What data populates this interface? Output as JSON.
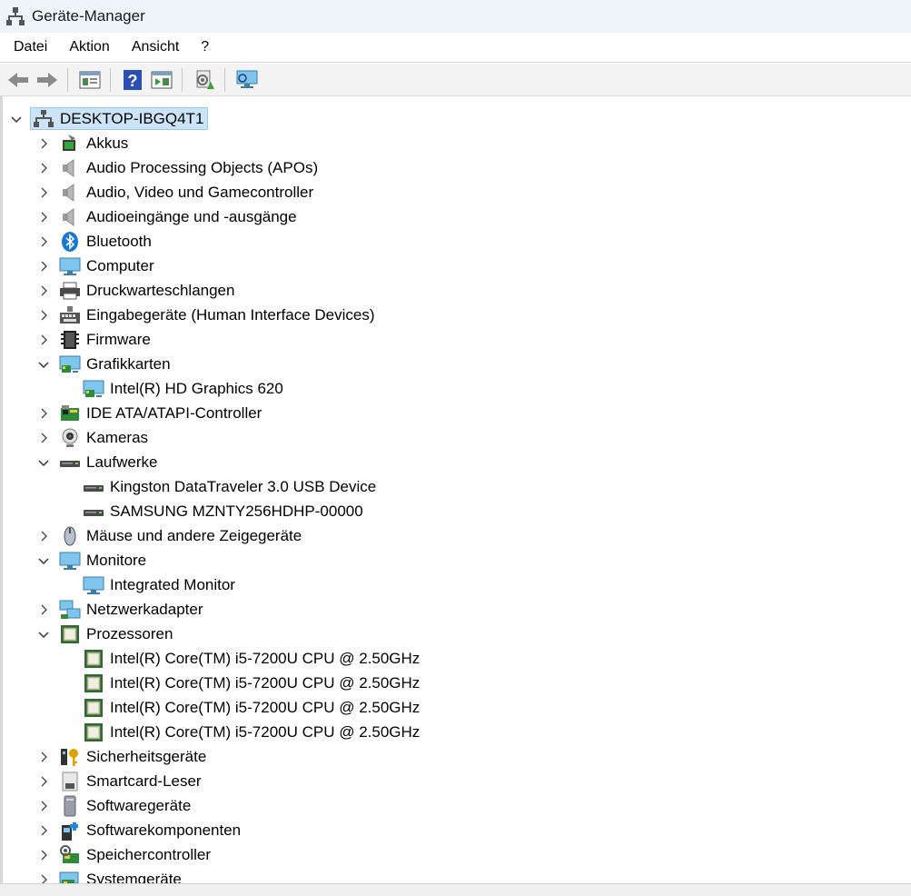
{
  "window": {
    "title": "Geräte-Manager"
  },
  "menu": [
    "Datei",
    "Aktion",
    "Ansicht",
    "?"
  ],
  "toolbar": {
    "buttons": [
      "back-arrow-icon",
      "forward-arrow-icon",
      "show-hide-console-tree-icon",
      "help-icon",
      "action-pane-icon",
      "update-driver-icon",
      "scan-hardware-changes-icon"
    ]
  },
  "tree": {
    "root": "DESKTOP-IBGQ4T1",
    "items": [
      {
        "label": "Akkus",
        "icon": "battery-icon",
        "level": 1,
        "state": "collapsed"
      },
      {
        "label": "Audio Processing Objects (APOs)",
        "icon": "speaker-icon",
        "level": 1,
        "state": "collapsed"
      },
      {
        "label": "Audio, Video und Gamecontroller",
        "icon": "speaker-icon",
        "level": 1,
        "state": "collapsed"
      },
      {
        "label": "Audioeingänge und -ausgänge",
        "icon": "speaker-icon",
        "level": 1,
        "state": "collapsed"
      },
      {
        "label": "Bluetooth",
        "icon": "bluetooth-icon",
        "level": 1,
        "state": "collapsed"
      },
      {
        "label": "Computer",
        "icon": "monitor-icon",
        "level": 1,
        "state": "collapsed"
      },
      {
        "label": "Druckwarteschlangen",
        "icon": "printer-icon",
        "level": 1,
        "state": "collapsed"
      },
      {
        "label": "Eingabegeräte (Human Interface Devices)",
        "icon": "keyboard-icon",
        "level": 1,
        "state": "collapsed"
      },
      {
        "label": "Firmware",
        "icon": "firmware-chip-icon",
        "level": 1,
        "state": "collapsed"
      },
      {
        "label": "Grafikkarten",
        "icon": "display-adapter-icon",
        "level": 1,
        "state": "expanded"
      },
      {
        "label": "Intel(R) HD Graphics 620",
        "icon": "display-adapter-icon",
        "level": 2,
        "state": "leaf"
      },
      {
        "label": "IDE ATA/ATAPI-Controller",
        "icon": "ide-controller-icon",
        "level": 1,
        "state": "collapsed"
      },
      {
        "label": "Kameras",
        "icon": "webcam-icon",
        "level": 1,
        "state": "collapsed"
      },
      {
        "label": "Laufwerke",
        "icon": "disk-drive-icon",
        "level": 1,
        "state": "expanded"
      },
      {
        "label": "Kingston DataTraveler 3.0 USB Device",
        "icon": "disk-drive-icon",
        "level": 2,
        "state": "leaf"
      },
      {
        "label": "SAMSUNG MZNTY256HDHP-00000",
        "icon": "disk-drive-icon",
        "level": 2,
        "state": "leaf"
      },
      {
        "label": "Mäuse und andere Zeigegeräte",
        "icon": "mouse-icon",
        "level": 1,
        "state": "collapsed"
      },
      {
        "label": "Monitore",
        "icon": "monitor-icon",
        "level": 1,
        "state": "expanded"
      },
      {
        "label": "Integrated Monitor",
        "icon": "monitor-icon",
        "level": 2,
        "state": "leaf"
      },
      {
        "label": "Netzwerkadapter",
        "icon": "network-adapter-icon",
        "level": 1,
        "state": "collapsed"
      },
      {
        "label": "Prozessoren",
        "icon": "processor-icon",
        "level": 1,
        "state": "expanded"
      },
      {
        "label": "Intel(R) Core(TM) i5-7200U CPU @ 2.50GHz",
        "icon": "processor-icon",
        "level": 2,
        "state": "leaf"
      },
      {
        "label": "Intel(R) Core(TM) i5-7200U CPU @ 2.50GHz",
        "icon": "processor-icon",
        "level": 2,
        "state": "leaf"
      },
      {
        "label": "Intel(R) Core(TM) i5-7200U CPU @ 2.50GHz",
        "icon": "processor-icon",
        "level": 2,
        "state": "leaf"
      },
      {
        "label": "Intel(R) Core(TM) i5-7200U CPU @ 2.50GHz",
        "icon": "processor-icon",
        "level": 2,
        "state": "leaf"
      },
      {
        "label": "Sicherheitsgeräte",
        "icon": "security-key-icon",
        "level": 1,
        "state": "collapsed"
      },
      {
        "label": "Smartcard-Leser",
        "icon": "smartcard-reader-icon",
        "level": 1,
        "state": "collapsed"
      },
      {
        "label": "Softwaregeräte",
        "icon": "software-device-icon",
        "level": 1,
        "state": "collapsed"
      },
      {
        "label": "Softwarekomponenten",
        "icon": "software-component-icon",
        "level": 1,
        "state": "collapsed"
      },
      {
        "label": "Speichercontroller",
        "icon": "storage-controller-icon",
        "level": 1,
        "state": "collapsed"
      },
      {
        "label": "Systemgeräte",
        "icon": "system-devices-icon",
        "level": 1,
        "state": "collapsed"
      }
    ]
  }
}
